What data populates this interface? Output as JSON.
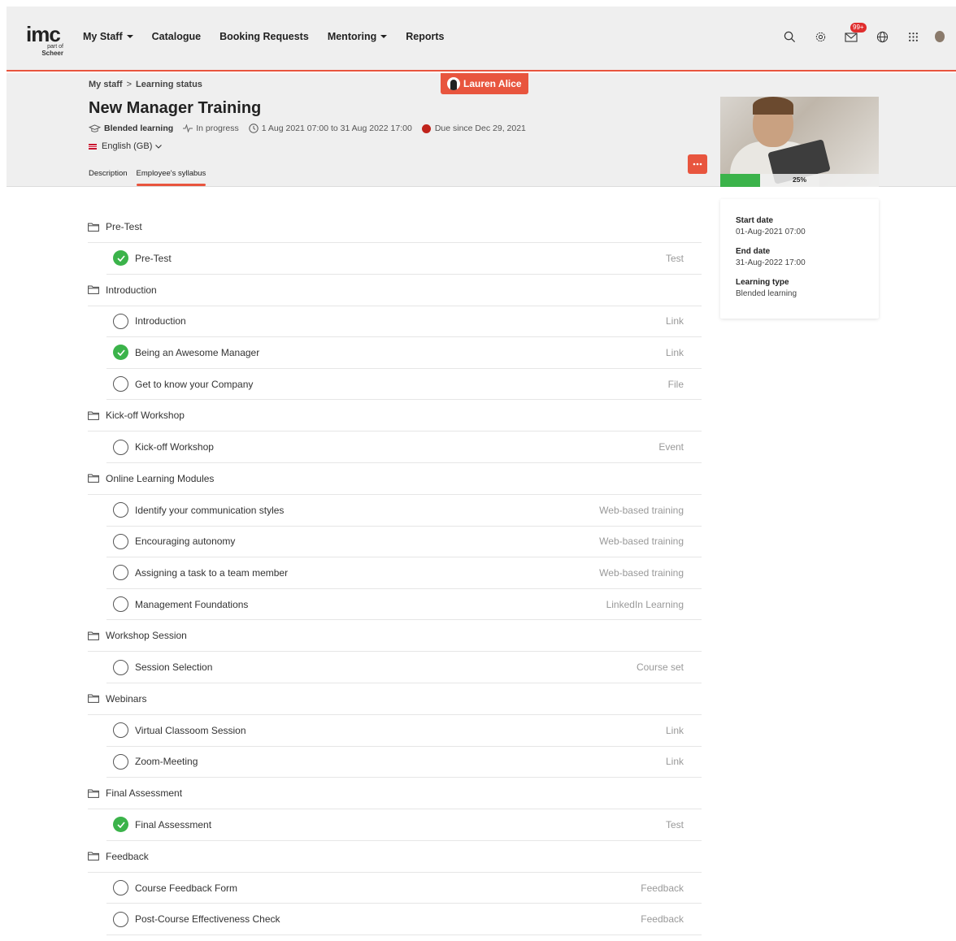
{
  "nav": {
    "logo_main": "imc",
    "logo_sub_prefix": "part of",
    "logo_sub_brand": "Scheer",
    "items": [
      {
        "label": "My Staff",
        "dropdown": true
      },
      {
        "label": "Catalogue",
        "dropdown": false
      },
      {
        "label": "Booking Requests",
        "dropdown": false
      },
      {
        "label": "Mentoring",
        "dropdown": true
      },
      {
        "label": "Reports",
        "dropdown": false
      }
    ],
    "messages_badge": "99+"
  },
  "breadcrumb": {
    "parent": "My staff",
    "separator": ">",
    "current": "Learning status"
  },
  "impersonation": {
    "user": "Lauren Alice"
  },
  "course": {
    "title": "New Manager Training",
    "type": "Blended learning",
    "status": "In progress",
    "dates": "1 Aug 2021 07:00 to 31 Aug 2022 17:00",
    "due": "Due since Dec 29, 2021",
    "language": "English (GB)",
    "progress_label": "25%",
    "progress_value": 0.25
  },
  "tabs": [
    "Description",
    "Employee's syllabus"
  ],
  "info": {
    "start_label": "Start date",
    "start_value": "01-Aug-2021 07:00",
    "end_label": "End date",
    "end_value": "31-Aug-2022 17:00",
    "type_label": "Learning type",
    "type_value": "Blended learning"
  },
  "syllabus": [
    {
      "section": "Pre-Test",
      "items": [
        {
          "title": "Pre-Test",
          "type": "Test",
          "done": true
        }
      ]
    },
    {
      "section": "Introduction",
      "items": [
        {
          "title": "Introduction",
          "type": "Link",
          "done": false
        },
        {
          "title": "Being an Awesome Manager",
          "type": "Link",
          "done": true
        },
        {
          "title": "Get to know your Company",
          "type": "File",
          "done": false
        }
      ]
    },
    {
      "section": "Kick-off Workshop",
      "items": [
        {
          "title": "Kick-off Workshop",
          "type": "Event",
          "done": false
        }
      ]
    },
    {
      "section": "Online Learning Modules",
      "items": [
        {
          "title": "Identify your communication styles",
          "type": "Web-based training",
          "done": false
        },
        {
          "title": "Encouraging autonomy",
          "type": "Web-based training",
          "done": false
        },
        {
          "title": "Assigning a task to a team member",
          "type": "Web-based training",
          "done": false
        },
        {
          "title": "Management Foundations",
          "type": "LinkedIn Learning",
          "done": false
        }
      ]
    },
    {
      "section": "Workshop Session",
      "items": [
        {
          "title": "Session Selection",
          "type": "Course set",
          "done": false
        }
      ]
    },
    {
      "section": "Webinars",
      "items": [
        {
          "title": "Virtual Classoom Session",
          "type": "Link",
          "done": false
        },
        {
          "title": "Zoom-Meeting",
          "type": "Link",
          "done": false
        }
      ]
    },
    {
      "section": "Final Assessment",
      "items": [
        {
          "title": "Final Assessment",
          "type": "Test",
          "done": true
        }
      ]
    },
    {
      "section": "Feedback",
      "items": [
        {
          "title": "Course Feedback Form",
          "type": "Feedback",
          "done": false
        },
        {
          "title": "Post-Course Effectiveness Check",
          "type": "Feedback",
          "done": false
        }
      ]
    }
  ],
  "colors": {
    "accent": "#e8553e",
    "success": "#3bb34a",
    "due": "#c0231b"
  }
}
